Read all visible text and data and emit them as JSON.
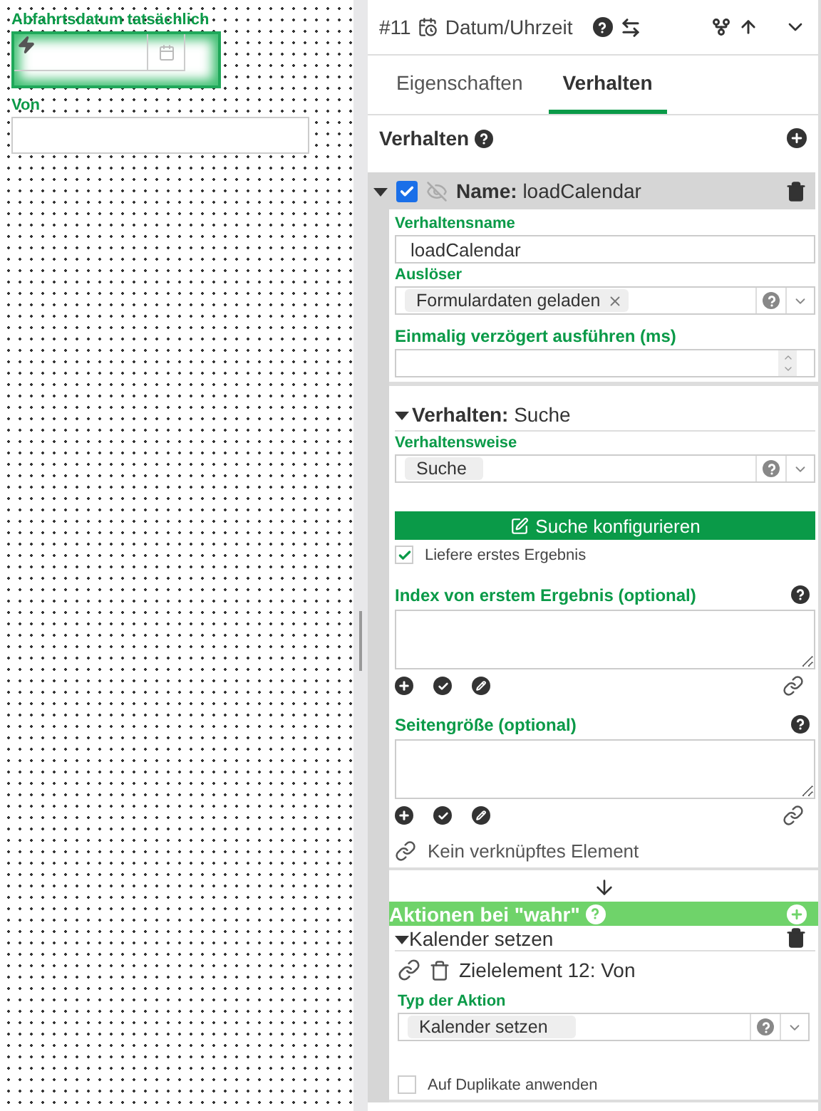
{
  "canvas": {
    "fields": [
      {
        "kind": "date",
        "label": "Abfahrtsdatum tatsächlich",
        "selected": true
      },
      {
        "kind": "text",
        "label": "Von",
        "selected": false
      }
    ]
  },
  "header": {
    "number": "#11",
    "title": "Datum/Uhrzeit"
  },
  "tabs": [
    {
      "label": "Eigenschaften",
      "selected": false
    },
    {
      "label": "Verhalten",
      "selected": true
    }
  ],
  "section_title": "Verhalten",
  "behavior": {
    "expanded": true,
    "enabled": true,
    "name_label": "Name:",
    "name": "loadCalendar",
    "fields": [
      {
        "kind": "text",
        "label": "Verhaltensname",
        "value": "loadCalendar"
      },
      {
        "kind": "select",
        "label": "Auslöser",
        "tags": [
          {
            "text": "Formulardaten geladen",
            "removable": true
          }
        ]
      },
      {
        "kind": "number",
        "label": "Einmalig verzögert ausführen (ms)"
      }
    ],
    "sub": {
      "expanded": true,
      "label": "Verhalten:",
      "value": "Suche",
      "mode_label": "Verhaltensweise",
      "mode": "Suche",
      "configure_button": "Suche konfigurieren",
      "first_result": {
        "label": "Liefere erstes Ergebnis",
        "checked": true
      },
      "params": [
        {
          "label": "Index von erstem Ergebnis (optional)"
        },
        {
          "label": "Seitengröße (optional)"
        }
      ],
      "linked": "Kein verknüpftes Element"
    },
    "actions": {
      "title": "Aktionen bei \"wahr\"",
      "items": [
        {
          "expanded": true,
          "title": "Kalender setzen",
          "target": "Zielelement 12: Von",
          "type_label": "Typ der Aktion",
          "type": "Kalender setzen",
          "duplicates": {
            "label": "Auf Duplikate anwenden",
            "checked": false
          }
        }
      ]
    }
  }
}
